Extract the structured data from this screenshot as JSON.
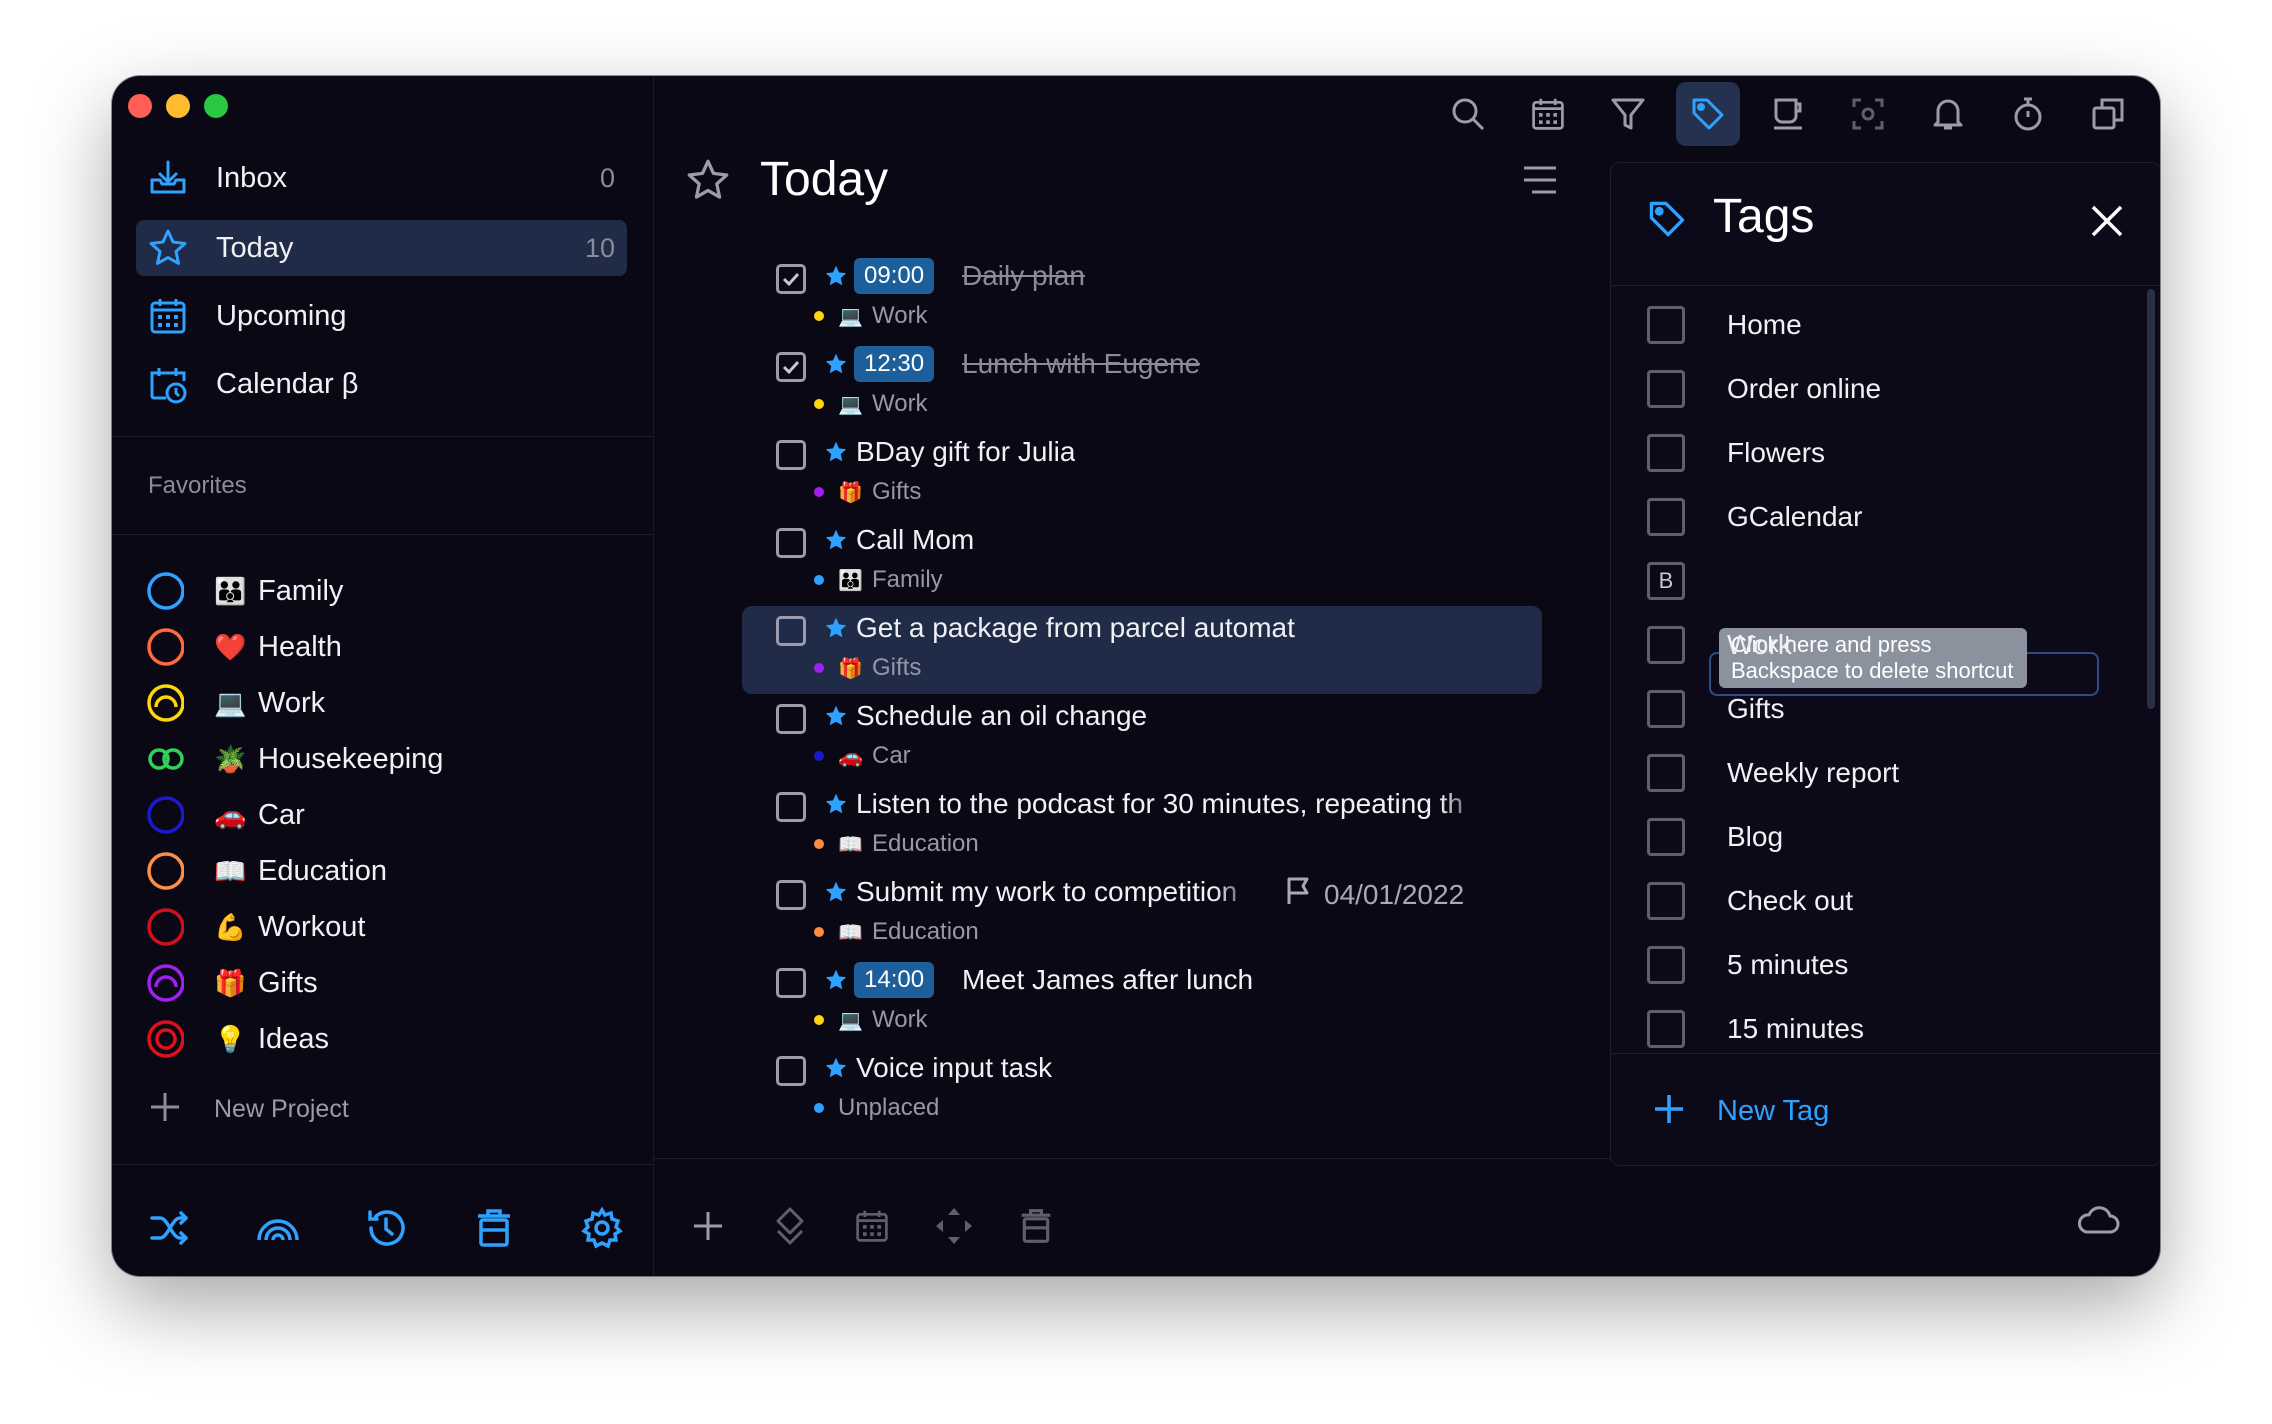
{
  "window": {
    "traffic_lights": [
      {
        "name": "close",
        "color": "#ff5f57"
      },
      {
        "name": "minimize",
        "color": "#febc2e"
      },
      {
        "name": "zoom",
        "color": "#28c840"
      }
    ]
  },
  "colors": {
    "accent": "#2fa1ff",
    "selected_bg": "#1f2b47",
    "background": "#0b0816"
  },
  "sidebar": {
    "nav": [
      {
        "label": "Inbox",
        "count": "0",
        "icon": "inbox-icon"
      },
      {
        "label": "Today",
        "count": "10",
        "icon": "star-icon",
        "active": true
      },
      {
        "label": "Upcoming",
        "count": "",
        "icon": "calendar-grid-icon"
      },
      {
        "label": "Calendar β",
        "count": "",
        "icon": "calendar-clock-icon"
      }
    ],
    "favorites_title": "Favorites",
    "projects": [
      {
        "label": "Family",
        "emoji": "👪",
        "ring_color": "#2fa1ff"
      },
      {
        "label": "Health",
        "emoji": "❤️",
        "ring_color": "#ff6a3d"
      },
      {
        "label": "Work",
        "emoji": "💻",
        "ring_color": "#ffd60a"
      },
      {
        "label": "Housekeeping",
        "emoji": "🪴",
        "ring_color": "#30d158"
      },
      {
        "label": "Car",
        "emoji": "🚗",
        "ring_color": "#1a1acc"
      },
      {
        "label": "Education",
        "emoji": "📖",
        "ring_color": "#ff8c42"
      },
      {
        "label": "Workout",
        "emoji": "💪",
        "ring_color": "#d0101a"
      },
      {
        "label": "Gifts",
        "emoji": "🎁",
        "ring_color": "#a020f0"
      },
      {
        "label": "Ideas",
        "emoji": "💡",
        "ring_color": "#e0101a"
      }
    ],
    "new_project_label": "New Project",
    "footer_icons": [
      "shuffle-icon",
      "rainbow-icon",
      "history-icon",
      "trash-icon",
      "settings-icon"
    ]
  },
  "toolbar": {
    "icons": [
      "search-icon",
      "calendar-grid-icon",
      "filter-icon",
      "tag-icon",
      "coffee-icon",
      "focus-icon",
      "bell-icon",
      "timer-icon",
      "copy-icon"
    ],
    "active": "tag-icon"
  },
  "main": {
    "title": "Today",
    "tasks": [
      {
        "title": "Daily plan",
        "time": "09:00",
        "done": true,
        "project": "Work",
        "emoji": "💻",
        "dot": "#ffd60a"
      },
      {
        "title": "Lunch with Eugene",
        "time": "12:30",
        "done": true,
        "project": "Work",
        "emoji": "💻",
        "dot": "#ffd60a"
      },
      {
        "title": "BDay gift for Julia",
        "time": "",
        "done": false,
        "project": "Gifts",
        "emoji": "🎁",
        "dot": "#a020f0"
      },
      {
        "title": "Call Mom",
        "time": "",
        "done": false,
        "project": "Family",
        "emoji": "👪",
        "dot": "#2fa1ff"
      },
      {
        "title": "Get a package from parcel automat",
        "time": "",
        "done": false,
        "project": "Gifts",
        "emoji": "🎁",
        "dot": "#a020f0",
        "selected": true
      },
      {
        "title": "Schedule an oil change",
        "time": "",
        "done": false,
        "project": "Car",
        "emoji": "🚗",
        "dot": "#1a1acc"
      },
      {
        "title": "Listen to the podcast for 30 minutes, repeating th",
        "time": "",
        "done": false,
        "project": "Education",
        "emoji": "📖",
        "dot": "#ff8c42"
      },
      {
        "title": "Submit my work to competition",
        "time": "",
        "done": false,
        "project": "Education",
        "emoji": "📖",
        "dot": "#ff8c42",
        "due": "04/01/2022"
      },
      {
        "title": "Meet James after lunch",
        "time": "14:00",
        "done": false,
        "project": "Work",
        "emoji": "💻",
        "dot": "#ffd60a"
      },
      {
        "title": "Voice input task",
        "time": "",
        "done": false,
        "project": "Unplaced",
        "emoji": "",
        "dot": "#2fa1ff"
      }
    ],
    "bottom_tools": [
      "add-icon",
      "move-icon",
      "calendar-grid-icon",
      "arrows-icon",
      "trash-icon"
    ]
  },
  "tags_panel": {
    "title": "Tags",
    "tags": [
      {
        "label": "Home",
        "shortcut": ""
      },
      {
        "label": "Order online",
        "shortcut": ""
      },
      {
        "label": "Flowers",
        "shortcut": ""
      },
      {
        "label": "GCalendar",
        "shortcut": ""
      },
      {
        "label": "",
        "shortcut": "B"
      },
      {
        "label": "Work",
        "shortcut": ""
      },
      {
        "label": "Gifts",
        "shortcut": ""
      },
      {
        "label": "Weekly report",
        "shortcut": ""
      },
      {
        "label": "Blog",
        "shortcut": ""
      },
      {
        "label": "Check out",
        "shortcut": ""
      },
      {
        "label": "5 minutes",
        "shortcut": ""
      },
      {
        "label": "15 minutes",
        "shortcut": ""
      }
    ],
    "tooltip": "Click here and press Backspace to delete shortcut",
    "new_tag_label": "New Tag"
  }
}
